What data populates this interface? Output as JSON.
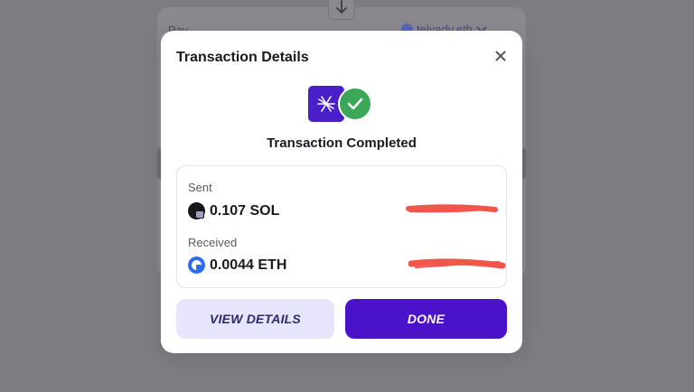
{
  "background": {
    "pay_label": "Pay",
    "account_name": "telvady.eth",
    "account_icon": "account-avatar-icon"
  },
  "modal": {
    "title": "Transaction Details",
    "close_icon": "close-icon",
    "status_text": "Transaction Completed",
    "sent": {
      "label": "Sent",
      "amount": "0.107 SOL",
      "token_icon": "sol-token-icon"
    },
    "received": {
      "label": "Received",
      "amount": "0.0044 ETH",
      "token_icon": "eth-token-icon"
    },
    "buttons": {
      "view_details": "VIEW DETAILS",
      "done": "DONE"
    }
  },
  "colors": {
    "overlay": "#7d7c82",
    "primary": "#4a12c9",
    "secondary_bg": "#e6e5fb",
    "success": "#3aa857",
    "redaction": "#f2554a"
  }
}
